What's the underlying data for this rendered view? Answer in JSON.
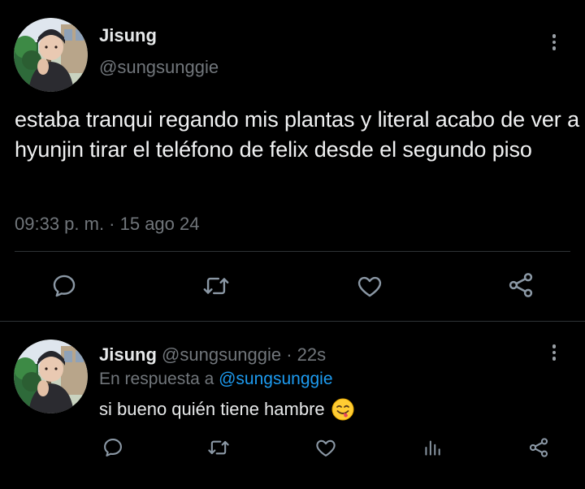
{
  "main_tweet": {
    "display_name": "Jisung",
    "handle": "@sungsunggie",
    "text": "estaba tranqui regando mis plantas y literal acabo de ver a hyunjin tirar el teléfono de felix desde el segundo piso",
    "timestamp": "09:33 p. m. · 15 ago 24",
    "avatar_icon": "profile-photo-person-beanie",
    "action_icons": [
      "reply-icon",
      "retweet-icon",
      "like-icon",
      "share-icon"
    ]
  },
  "reply_tweet": {
    "display_name": "Jisung",
    "handle_time": "@sungsunggie · 22s",
    "replying_prefix": "En respuesta a",
    "replying_mention": "@sungsunggie",
    "text": "si bueno quién tiene hambre",
    "emoji": "face-savoring-food-emoji",
    "avatar_icon": "profile-photo-person-beanie",
    "action_icons": [
      "reply-icon",
      "retweet-icon",
      "like-icon",
      "views-icon",
      "share-icon"
    ]
  },
  "colors": {
    "background": "#000000",
    "primary_text": "#e7e9ea",
    "secondary_text": "#71767b",
    "link": "#1d9bf0",
    "divider": "#2f3336",
    "icon": "#8b98a5"
  }
}
